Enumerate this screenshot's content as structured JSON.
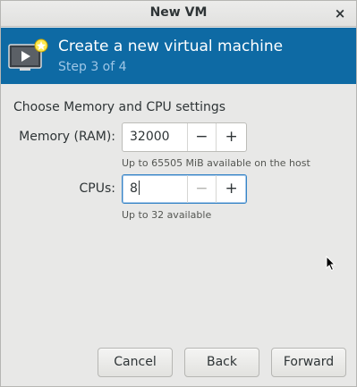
{
  "window": {
    "title": "New VM",
    "close_glyph": "×"
  },
  "header": {
    "title": "Create a new virtual machine",
    "step": "Step 3 of 4",
    "icon": "vm-monitor-icon",
    "bg_color": "#0e6aa4"
  },
  "section": {
    "title": "Choose Memory and CPU settings"
  },
  "memory": {
    "label": "Memory (RAM):",
    "value": "32000",
    "minus": "−",
    "plus": "+",
    "hint": "Up to 65505 MiB available on the host"
  },
  "cpus": {
    "label": "CPUs:",
    "value": "8",
    "minus": "−",
    "plus": "+",
    "hint": "Up to 32 available"
  },
  "footer": {
    "cancel": "Cancel",
    "back": "Back",
    "forward": "Forward"
  }
}
